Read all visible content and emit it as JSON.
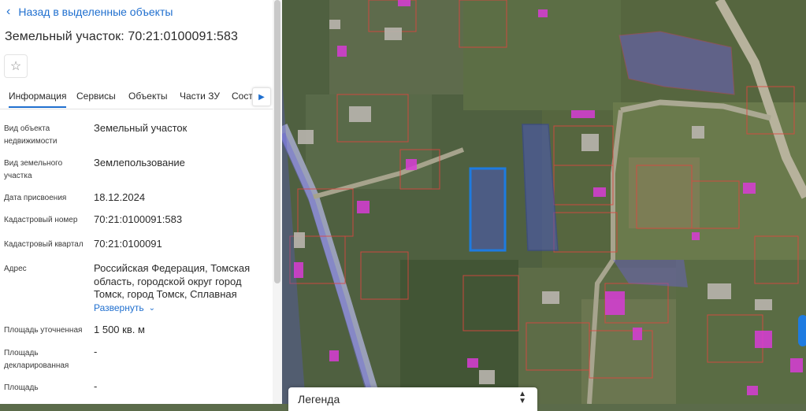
{
  "back_link": "Назад в выделенные объекты",
  "title": "Земельный участок: 70:21:0100091:583",
  "tabs": [
    "Информация",
    "Сервисы",
    "Объекты",
    "Части ЗУ",
    "Соста"
  ],
  "fields": {
    "object_type_label": "Вид объекта недвижимости",
    "object_type": "Земельный участок",
    "land_type_label": "Вид земельного участка",
    "land_type": "Землепользование",
    "date_label": "Дата присвоения",
    "date": "18.12.2024",
    "cad_number_label": "Кадастровый номер",
    "cad_number": "70:21:0100091:583",
    "cad_quarter_label": "Кадастровый квартал",
    "cad_quarter": "70:21:0100091",
    "address_label": "Адрес",
    "address": "Российская Федерация, Томская область, городской округ город Томск, город Томск, Сплавная",
    "expand_label": "Развернуть",
    "area_specified_label": "Площадь уточненная",
    "area_specified": "1 500 кв. м",
    "area_declared_label": "Площадь декларированная",
    "area_declared": "-",
    "area_label": "Площадь",
    "area": "-"
  },
  "legend": {
    "title": "Легенда"
  },
  "icons": {
    "back": "chevron-left-icon",
    "star": "star-icon",
    "tab_next": "chevron-right-icon",
    "expand": "chevron-down-icon",
    "legend_toggle": "sort-arrows-icon"
  },
  "colors": {
    "accent": "#1f6fcf",
    "selected_parcel": "#1e7be0",
    "parcel_border": "#e0453f",
    "building": "#d83cd6",
    "highlight_fill": "#6a5fd0"
  }
}
